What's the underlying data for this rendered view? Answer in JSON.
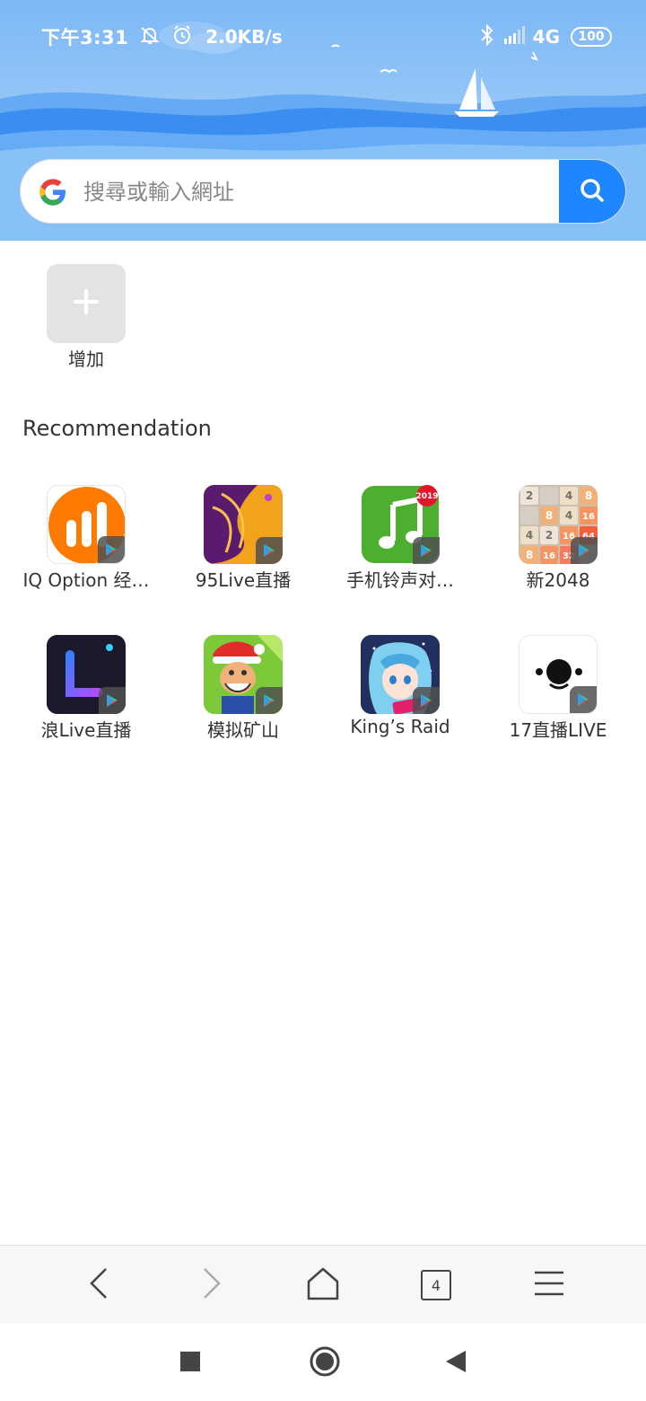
{
  "status_bar": {
    "time": "下午3:31",
    "net_speed": "2.0KB/s",
    "network": "4G",
    "battery": "100"
  },
  "search": {
    "placeholder": "搜尋或輸入網址",
    "logo_icon": "google-icon",
    "button_icon": "search-icon"
  },
  "shortcuts": {
    "add_label": "增加"
  },
  "recommendation": {
    "title": "Recommendation",
    "apps": [
      {
        "label": "IQ Option 经…",
        "icon": "iq-option-icon"
      },
      {
        "label": "95Live直播",
        "icon": "95live-icon"
      },
      {
        "label": "手机铃声对…",
        "icon": "ringtone-icon",
        "badge": "2019"
      },
      {
        "label": "新2048",
        "icon": "game-2048-icon"
      },
      {
        "label": "浪Live直播",
        "icon": "lang-live-icon"
      },
      {
        "label": "模拟矿山",
        "icon": "mine-sim-icon"
      },
      {
        "label": "King’s Raid",
        "icon": "kings-raid-icon"
      },
      {
        "label": "17直播LIVE",
        "icon": "17live-icon"
      }
    ],
    "grid_2048": [
      "2",
      "",
      "4",
      "8",
      "",
      "8",
      "4",
      "16",
      "4",
      "2",
      "16",
      "64",
      "8",
      "16",
      "32",
      ""
    ]
  },
  "toolbar": {
    "tab_count": "4"
  },
  "colors": {
    "header_sky": "#7fbaf6",
    "accent": "#1e86ff",
    "wave_dark": "#3a8cf0"
  }
}
